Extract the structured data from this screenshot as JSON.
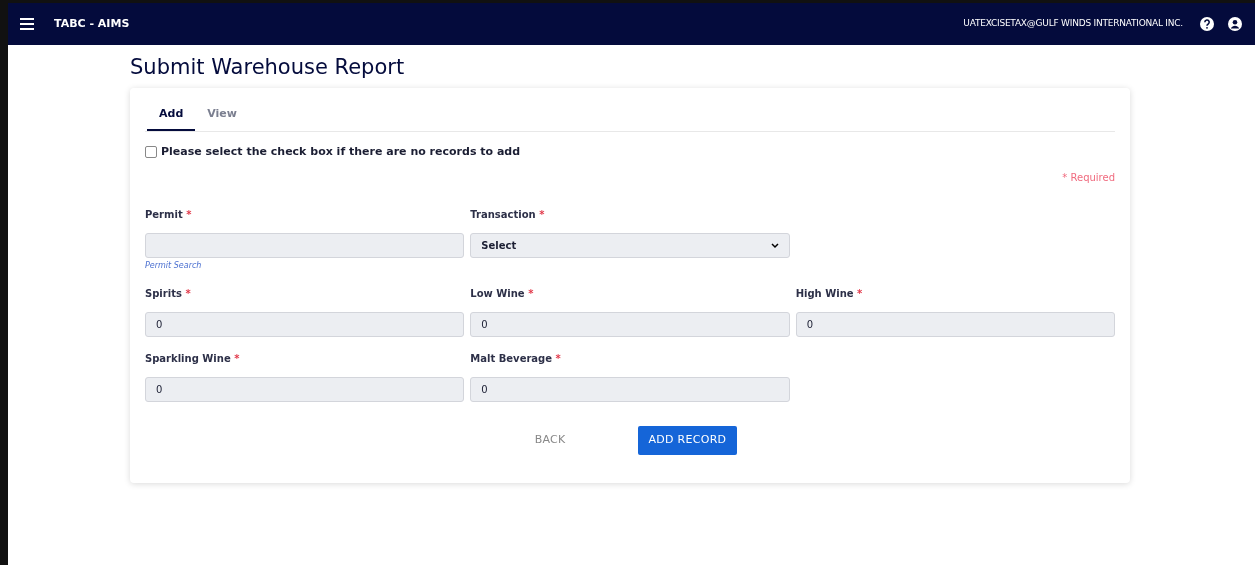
{
  "app": {
    "title": "TABC - AIMS",
    "user": "UATEXCISETAX@GULF WINDS INTERNATIONAL INC."
  },
  "page_title": "Submit Warehouse Report",
  "tabs": [
    {
      "label": "Add",
      "selected": true
    },
    {
      "label": "View",
      "selected": false
    }
  ],
  "no_records_checkbox": {
    "label": "Please select the check box if there are no records to add",
    "checked": false
  },
  "required_note": "Required",
  "required_mark": "*",
  "fields": [
    {
      "kind": "text",
      "label": "Permit",
      "hint": "Permit Search"
    },
    {
      "kind": "select",
      "label": "Transaction",
      "value": "Select"
    },
    {
      "kind": "spacer"
    },
    {
      "kind": "text",
      "label": "Spirits",
      "value": "0"
    },
    {
      "kind": "text",
      "label": "Low Wine",
      "value": "0"
    },
    {
      "kind": "text",
      "label": "High Wine",
      "value": "0"
    },
    {
      "kind": "text",
      "label": "Sparkling Wine",
      "value": "0"
    },
    {
      "kind": "text",
      "label": "Malt Beverage",
      "value": "0"
    }
  ],
  "buttons": {
    "back": "BACK",
    "add": "ADD RECORD"
  }
}
